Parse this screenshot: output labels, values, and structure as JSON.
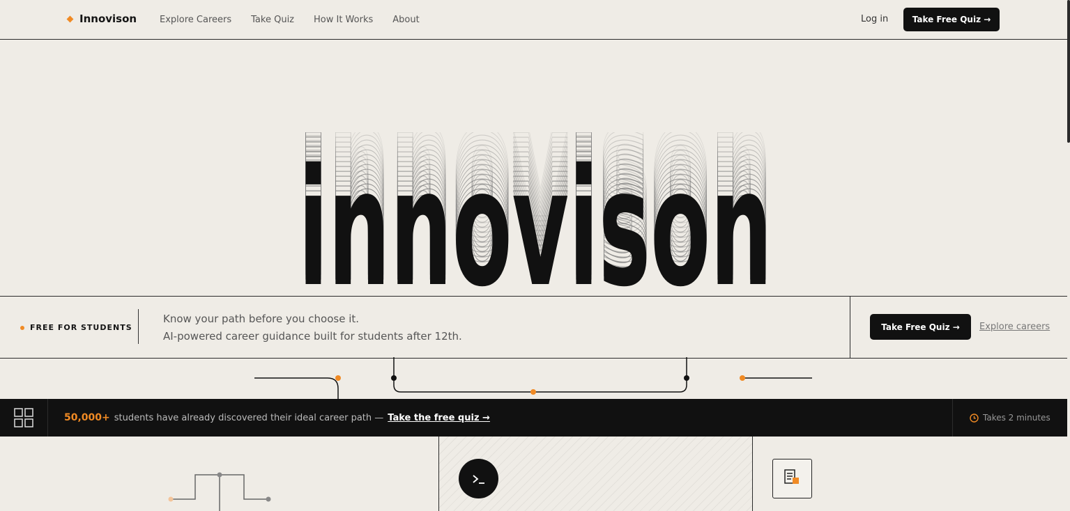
{
  "nav": {
    "brand": "Innovison",
    "links": [
      "Explore Careers",
      "Take Quiz",
      "How It Works",
      "About"
    ],
    "login": "Log in",
    "cta": "Take Free Quiz →"
  },
  "hero": {
    "word": "innovison"
  },
  "strip": {
    "badge": "FREE FOR STUDENTS",
    "line1": "Know your path before you choose it.",
    "line2": "AI-powered career guidance built for students after 12th.",
    "cta": "Take Free Quiz →",
    "link": "Explore careers"
  },
  "band": {
    "count": "50,000+",
    "text": "students have already discovered their ideal career path —",
    "link": "Take the free quiz →",
    "time": "Takes 2 minutes"
  },
  "icons": {
    "brand": "diamond-icon",
    "grid": "grid-icon",
    "clock": "clock-icon",
    "terminal": "terminal-icon",
    "document": "document-icon"
  },
  "colors": {
    "accent": "#f08a24",
    "dark": "#111111",
    "background": "#efece6"
  }
}
